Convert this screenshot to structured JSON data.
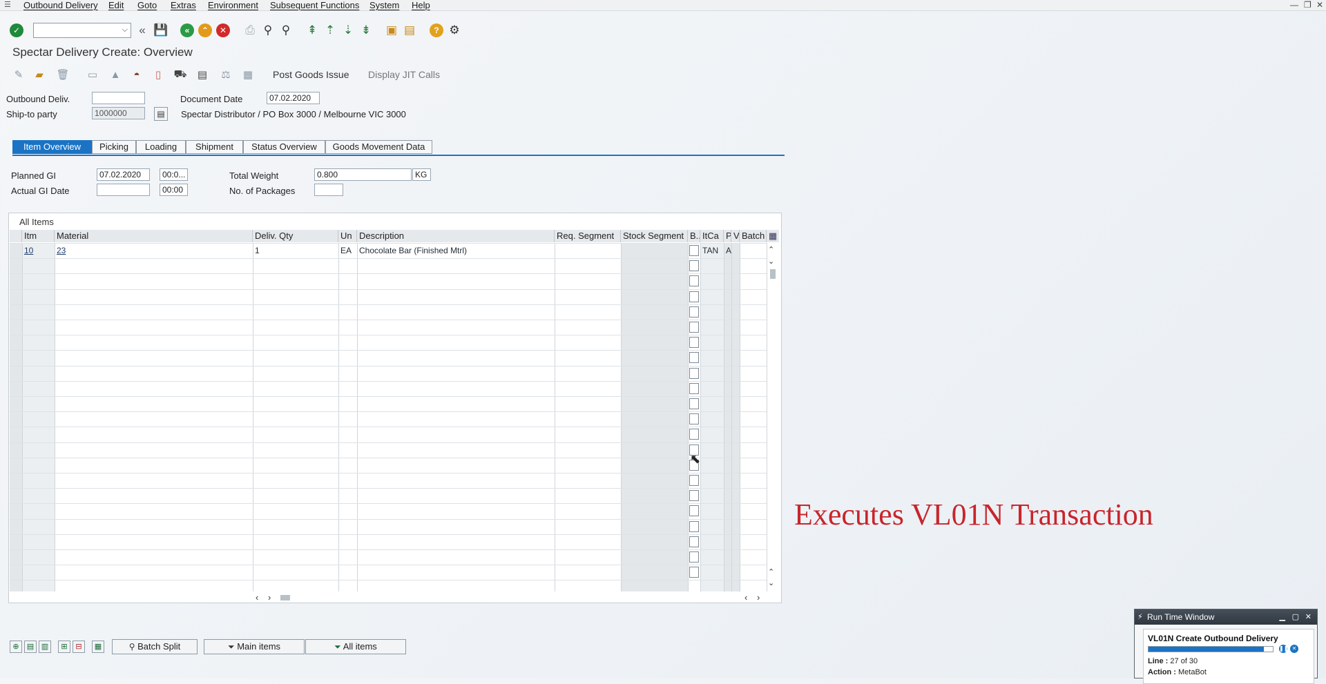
{
  "menu": {
    "items": [
      "Outbound Delivery",
      "Edit",
      "Goto",
      "Extras",
      "Environment",
      "Subsequent Functions",
      "System",
      "Help"
    ]
  },
  "window_controls": {
    "minimize": "—",
    "restore": "❐",
    "close": "✕"
  },
  "toolbar": {
    "command_field": ""
  },
  "page": {
    "title": "Spectar Delivery  Create: Overview"
  },
  "app_toolbar": {
    "post_goods_issue": "Post Goods Issue",
    "display_jit_calls": "Display JIT Calls"
  },
  "header": {
    "outbound_deliv_label": "Outbound Deliv.",
    "outbound_deliv_value": "",
    "document_date_label": "Document Date",
    "document_date_value": "07.02.2020",
    "ship_to_label": "Ship-to party",
    "ship_to_value": "1000000",
    "ship_to_address": "Spectar Distributor / PO Box 3000 / Melbourne VIC 3000"
  },
  "tabs": [
    "Item Overview",
    "Picking",
    "Loading",
    "Shipment",
    "Status Overview",
    "Goods Movement Data"
  ],
  "overview": {
    "planned_gi_label": "Planned GI",
    "planned_gi_date": "07.02.2020",
    "planned_gi_time": "00:0...",
    "actual_gi_label": "Actual GI Date",
    "actual_gi_date": "",
    "actual_gi_time": "00:00",
    "total_weight_label": "Total Weight",
    "total_weight_value": "0.800",
    "weight_unit": "KG",
    "packages_label": "No. of Packages",
    "packages_value": ""
  },
  "table": {
    "title": "All Items",
    "columns": [
      "Itm",
      "Material",
      "Deliv. Qty",
      "Un",
      "Description",
      "Req. Segment",
      "Stock Segment",
      "B..",
      "ItCa",
      "P",
      "V",
      "Batch"
    ],
    "rows": [
      {
        "itm": "10",
        "material": "23",
        "qty": "1",
        "un": "EA",
        "description": "Chocolate Bar (Finished Mtrl)",
        "req_segment": "",
        "stock_segment": "",
        "itca": "TAN",
        "p": "A",
        "v": "",
        "batch": ""
      }
    ]
  },
  "bottom_buttons": {
    "batch_split": "Batch Split",
    "main_items": "Main items",
    "all_items": "All items"
  },
  "caption": "Executes VL01N   Transaction",
  "runtime_window": {
    "title": "Run Time Window",
    "task": "VL01N Create Outbound Delivery",
    "progress": 0.93,
    "line_label": "Line :",
    "line_value": "27 of 30",
    "action_label": "Action :",
    "action_value": "MetaBot"
  },
  "colors": {
    "accent": "#1a73c4",
    "caption": "#c8252b",
    "ok_green": "#1e8a3a",
    "nav_green": "#2b9a47",
    "nav_orange": "#e39a1a",
    "cancel_red": "#d12a2a",
    "help": "#e3a21a"
  }
}
